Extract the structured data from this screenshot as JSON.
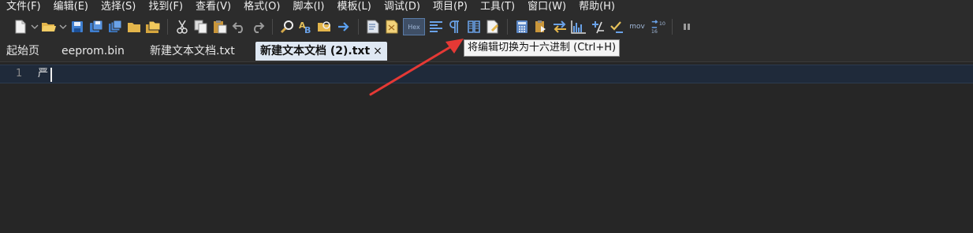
{
  "menu": [
    "文件(F)",
    "编辑(E)",
    "选择(S)",
    "找到(F)",
    "查看(V)",
    "格式(O)",
    "脚本(I)",
    "模板(L)",
    "调试(D)",
    "项目(P)",
    "工具(T)",
    "窗口(W)",
    "帮助(H)"
  ],
  "toolbar": {
    "hex_label": "Hex",
    "mov_label": "mov",
    "base_label_top": "10",
    "base_label_bottom": "16"
  },
  "tabs": [
    {
      "label": "起始页",
      "active": false
    },
    {
      "label": "eeprom.bin",
      "active": false
    },
    {
      "label": "新建文本文档.txt",
      "active": false
    },
    {
      "label": "新建文本文档 (2).txt",
      "active": true
    }
  ],
  "tab_close": "×",
  "editor": {
    "line_number": "1",
    "line_text": "严"
  },
  "tooltip": "将编辑切换为十六进制 (Ctrl+H)",
  "colors": {
    "background": "#262626",
    "annotation_arrow": "#e53935",
    "active_tab": "#dfe8f3"
  }
}
